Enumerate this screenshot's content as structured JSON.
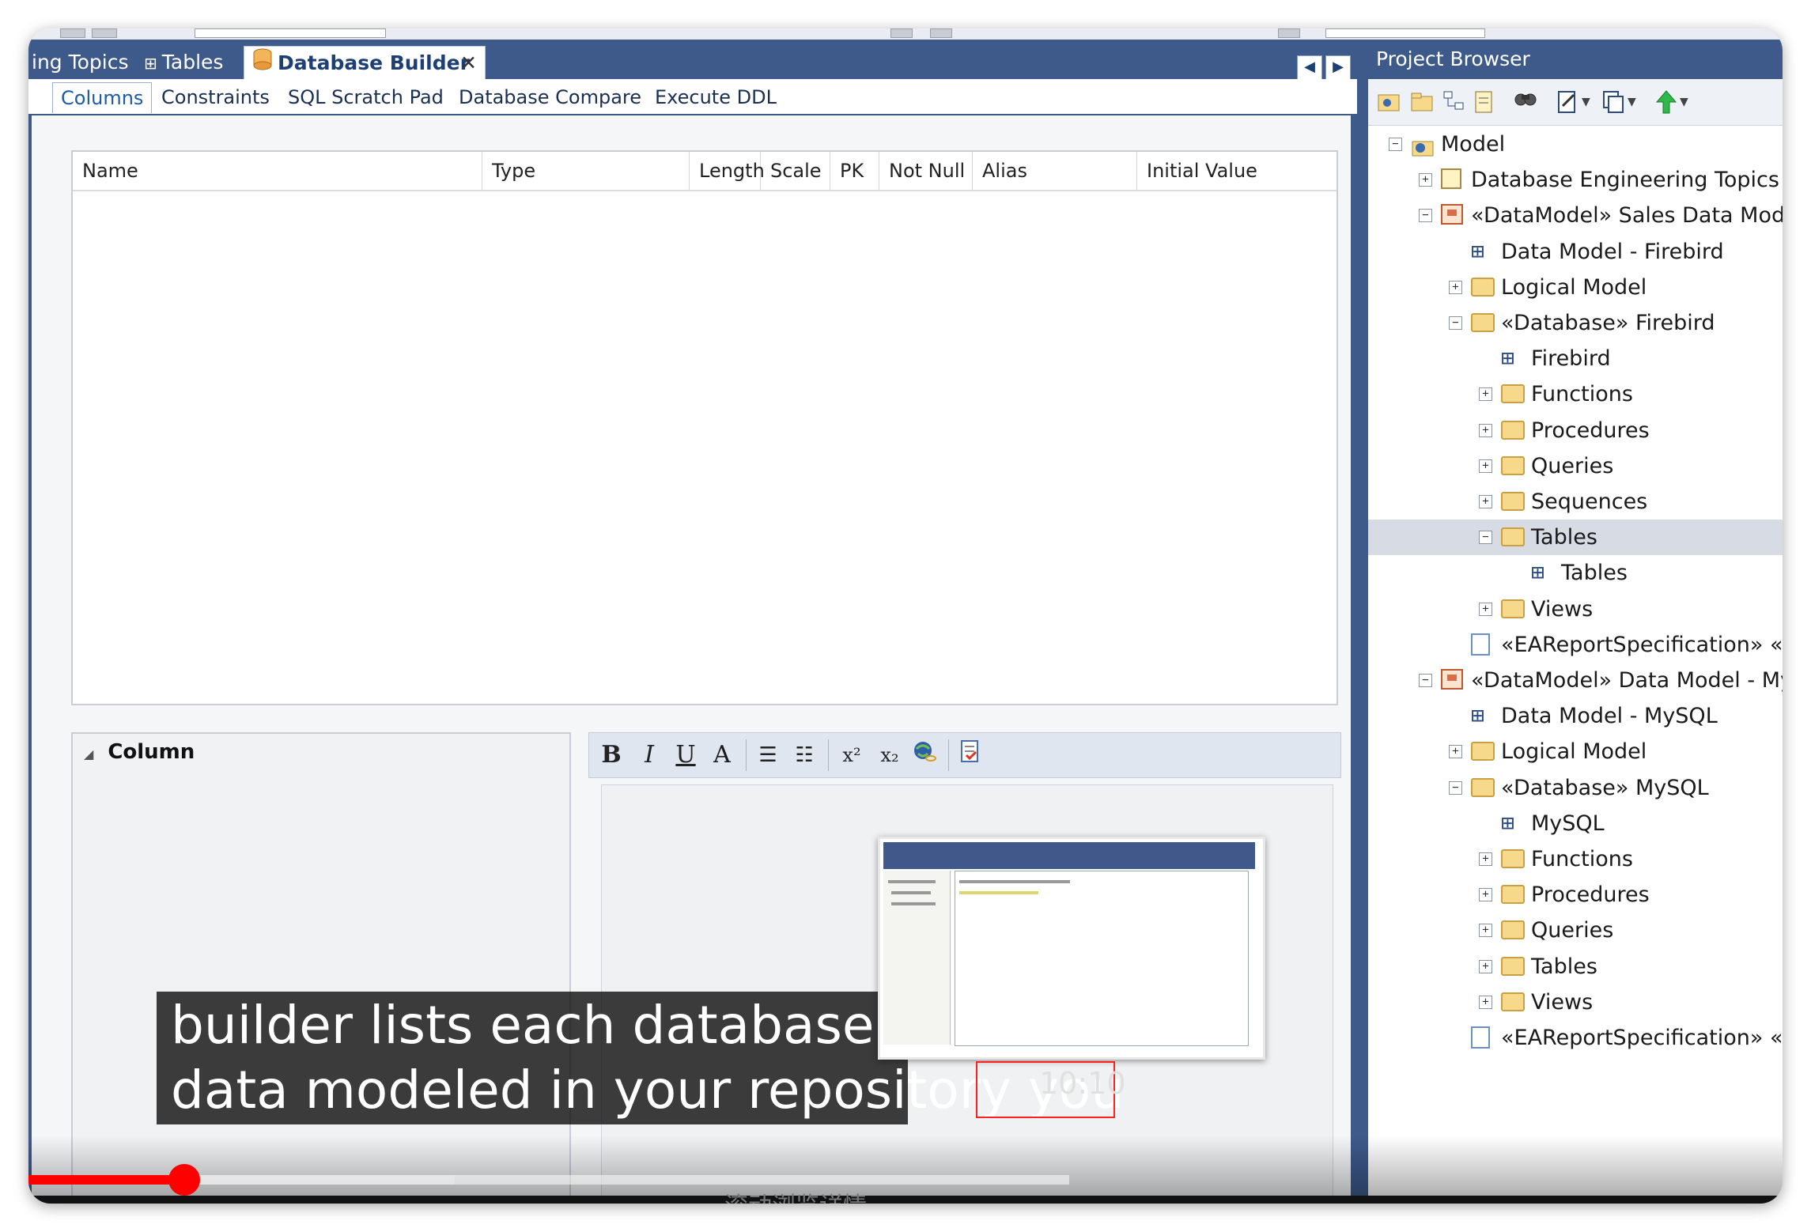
{
  "doc_tabs": {
    "tab1": "ing Topics",
    "tab2": "Tables",
    "tab3": "Database Builder",
    "close": "✕",
    "nav_left": "◀",
    "nav_right": "▶"
  },
  "sub_tabs": [
    "Columns",
    "Constraints",
    "SQL Scratch Pad",
    "Database Compare",
    "Execute DDL"
  ],
  "grid_columns": [
    "Name",
    "Type",
    "Length",
    "Scale",
    "PK",
    "Not Null",
    "Alias",
    "Initial Value"
  ],
  "column_panel": {
    "title": "Column"
  },
  "rich_toolbar": {
    "bold": "B",
    "italic": "I",
    "underline": "U",
    "font": "A",
    "sup": "x²",
    "sub": "x₂"
  },
  "project_browser": {
    "title": "Project Browser",
    "nodes": [
      {
        "label": "Model",
        "icon": "model-icon"
      },
      {
        "label": "Database Engineering Topics",
        "icon": "topics-icon"
      },
      {
        "label": "«DataModel» Sales Data Model -",
        "icon": "package-icon"
      },
      {
        "label": "Data Model - Firebird",
        "icon": "diagram-icon"
      },
      {
        "label": "Logical Model",
        "icon": "folder-icon"
      },
      {
        "label": "«Database» Firebird",
        "icon": "folder-icon"
      },
      {
        "label": "Firebird",
        "icon": "diagram-icon"
      },
      {
        "label": "Functions",
        "icon": "folder-icon"
      },
      {
        "label": "Procedures",
        "icon": "folder-icon"
      },
      {
        "label": "Queries",
        "icon": "folder-icon"
      },
      {
        "label": "Sequences",
        "icon": "folder-icon"
      },
      {
        "label": "Tables",
        "icon": "folder-icon"
      },
      {
        "label": "Tables",
        "icon": "diagram-icon"
      },
      {
        "label": "Views",
        "icon": "folder-icon"
      },
      {
        "label": "«EAReportSpecification» «Da",
        "icon": "document-icon"
      },
      {
        "label": "«DataModel» Data Model - MyS",
        "icon": "package-icon"
      },
      {
        "label": "Data Model - MySQL",
        "icon": "diagram-icon"
      },
      {
        "label": "Logical Model",
        "icon": "folder-icon"
      },
      {
        "label": "«Database» MySQL",
        "icon": "folder-icon"
      },
      {
        "label": "MySQL",
        "icon": "diagram-icon"
      },
      {
        "label": "Functions",
        "icon": "folder-icon"
      },
      {
        "label": "Procedures",
        "icon": "folder-icon"
      },
      {
        "label": "Queries",
        "icon": "folder-icon"
      },
      {
        "label": "Tables",
        "icon": "folder-icon"
      },
      {
        "label": "Views",
        "icon": "folder-icon"
      },
      {
        "label": "«EAReportSpecification» «Da",
        "icon": "document-icon"
      }
    ]
  },
  "video": {
    "caption_line1": "builder lists each database c",
    "caption_line2": "data modeled in your repository you",
    "preview_time": "10:10",
    "below_text": "滚动浏览详情",
    "progress_fraction": 0.089,
    "buffer_fraction": 0.243,
    "accent": "#ff0000"
  }
}
